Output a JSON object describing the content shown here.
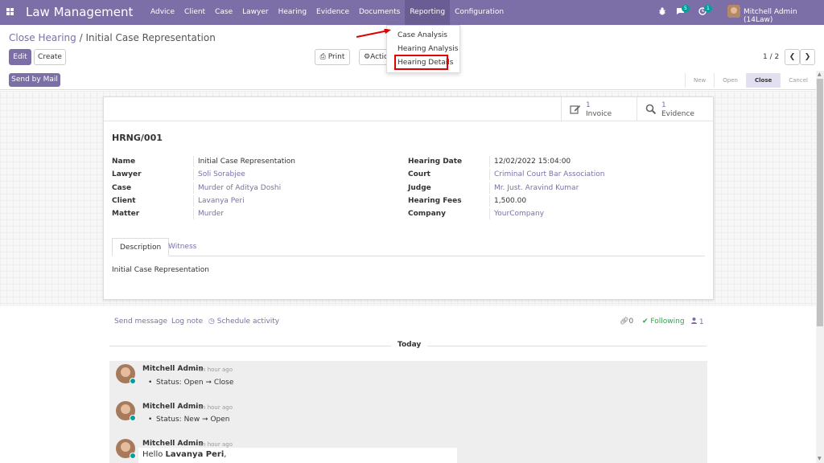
{
  "navbar": {
    "brand": "Law Management",
    "menu": [
      "Advice",
      "Client",
      "Case",
      "Lawyer",
      "Hearing",
      "Evidence",
      "Documents",
      "Reporting",
      "Configuration"
    ],
    "active_menu": "Reporting",
    "messages_count": "5",
    "activities_count": "1",
    "user": "Mitchell Admin (14Law)"
  },
  "breadcrumb": {
    "parent": "Close Hearing",
    "separator": "/",
    "current": "Initial Case Representation"
  },
  "toolbar": {
    "edit": "Edit",
    "create": "Create",
    "print": "Print",
    "action": "Actio",
    "pager": "1 / 2",
    "prev": "❮",
    "next": "❯",
    "send_by_mail": "Send by Mail"
  },
  "stages": [
    "New",
    "Open",
    "Close",
    "Cancel"
  ],
  "current_stage": "Close",
  "reporting_dropdown": {
    "items": [
      "Case Analysis",
      "Hearing Analysis",
      "Hearing Details"
    ],
    "highlighted": "Hearing Details"
  },
  "smart_buttons": [
    {
      "value": "1",
      "label": "Invoice",
      "icon": "edit-icon"
    },
    {
      "value": "1",
      "label": "Evidence",
      "icon": "search-icon"
    }
  ],
  "record": {
    "name": "HRNG/001",
    "left_fields": [
      {
        "label": "Name",
        "value": "Initial Case Representation"
      },
      {
        "label": "Lawyer",
        "value": "Soli Sorabjee"
      },
      {
        "label": "Case",
        "value": "Murder of Aditya Doshi"
      },
      {
        "label": "Client",
        "value": "Lavanya Peri"
      },
      {
        "label": "Matter",
        "value": "Murder"
      }
    ],
    "right_fields": [
      {
        "label": "Hearing Date",
        "value": "12/02/2022 15:04:00"
      },
      {
        "label": "Court",
        "value": "Criminal Court Bar Association"
      },
      {
        "label": "Judge",
        "value": "Mr. Just. Aravind Kumar"
      },
      {
        "label": "Hearing Fees",
        "value": "1,500.00"
      },
      {
        "label": "Company",
        "value": "YourCompany"
      }
    ]
  },
  "tabs": [
    "Description",
    "Witness"
  ],
  "description": "Initial Case Representation",
  "chatter": {
    "send_message": "Send message",
    "log_note": "Log note",
    "schedule_activity": "Schedule activity",
    "attachments": "0",
    "following": "Following",
    "followers": "1",
    "today": "Today",
    "messages": [
      {
        "author": "Mitchell Admin",
        "time": "- an hour ago",
        "body": "Status: Open ➞ Close"
      },
      {
        "author": "Mitchell Admin",
        "time": "- an hour ago",
        "body": "Status: New ➞ Open"
      },
      {
        "author": "Mitchell Admin",
        "time": "- an hour ago",
        "greeting": "Hello",
        "recipient": "Lavanya Peri",
        "comma": ","
      }
    ]
  },
  "colors": {
    "brand": "#7c6fa7",
    "following": "#28a745",
    "highlight": "#e00000",
    "online": "#00a09d"
  }
}
